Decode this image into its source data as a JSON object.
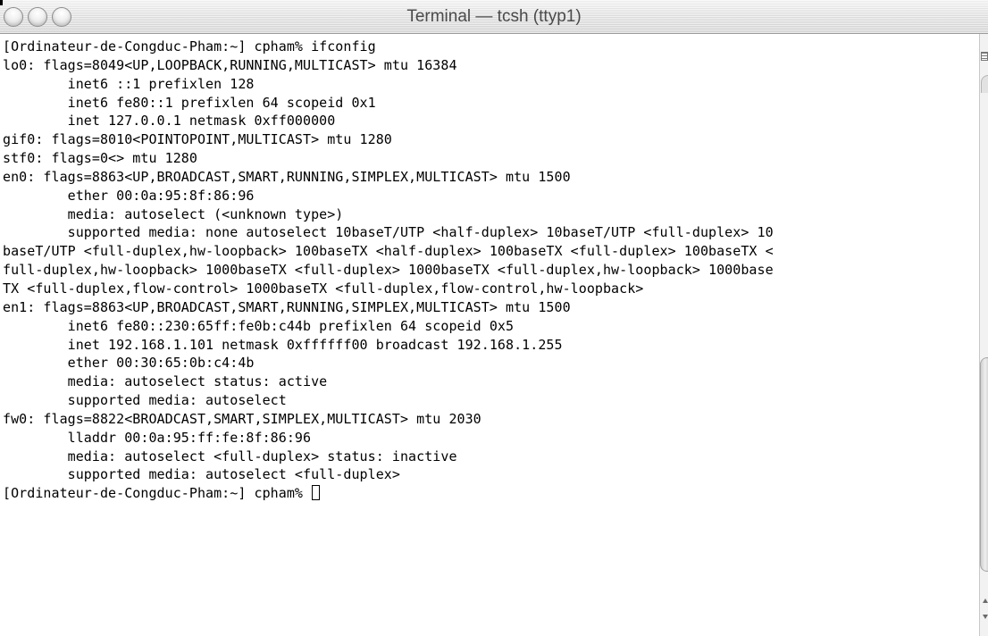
{
  "window": {
    "title": "Terminal — tcsh (ttyp1)"
  },
  "terminal": {
    "lines": [
      "[Ordinateur-de-Congduc-Pham:~] cpham% ifconfig",
      "lo0: flags=8049<UP,LOOPBACK,RUNNING,MULTICAST> mtu 16384",
      "        inet6 ::1 prefixlen 128",
      "        inet6 fe80::1 prefixlen 64 scopeid 0x1",
      "        inet 127.0.0.1 netmask 0xff000000",
      "gif0: flags=8010<POINTOPOINT,MULTICAST> mtu 1280",
      "stf0: flags=0<> mtu 1280",
      "en0: flags=8863<UP,BROADCAST,SMART,RUNNING,SIMPLEX,MULTICAST> mtu 1500",
      "        ether 00:0a:95:8f:86:96",
      "        media: autoselect (<unknown type>)",
      "        supported media: none autoselect 10baseT/UTP <half-duplex> 10baseT/UTP <full-duplex> 10",
      "baseT/UTP <full-duplex,hw-loopback> 100baseTX <half-duplex> 100baseTX <full-duplex> 100baseTX <",
      "full-duplex,hw-loopback> 1000baseTX <full-duplex> 1000baseTX <full-duplex,hw-loopback> 1000base",
      "TX <full-duplex,flow-control> 1000baseTX <full-duplex,flow-control,hw-loopback>",
      "en1: flags=8863<UP,BROADCAST,SMART,RUNNING,SIMPLEX,MULTICAST> mtu 1500",
      "        inet6 fe80::230:65ff:fe0b:c44b prefixlen 64 scopeid 0x5",
      "        inet 192.168.1.101 netmask 0xffffff00 broadcast 192.168.1.255",
      "        ether 00:30:65:0b:c4:4b",
      "        media: autoselect status: active",
      "        supported media: autoselect",
      "fw0: flags=8822<BROADCAST,SMART,SIMPLEX,MULTICAST> mtu 2030",
      "        lladdr 00:0a:95:ff:fe:8f:86:96",
      "        media: autoselect <full-duplex> status: inactive",
      "        supported media: autoselect <full-duplex>"
    ],
    "prompt": "[Ordinateur-de-Congduc-Pham:~] cpham% "
  },
  "icons": {
    "close": "close-button-icon",
    "minimize": "minimize-button-icon",
    "zoom": "zoom-button-icon"
  }
}
